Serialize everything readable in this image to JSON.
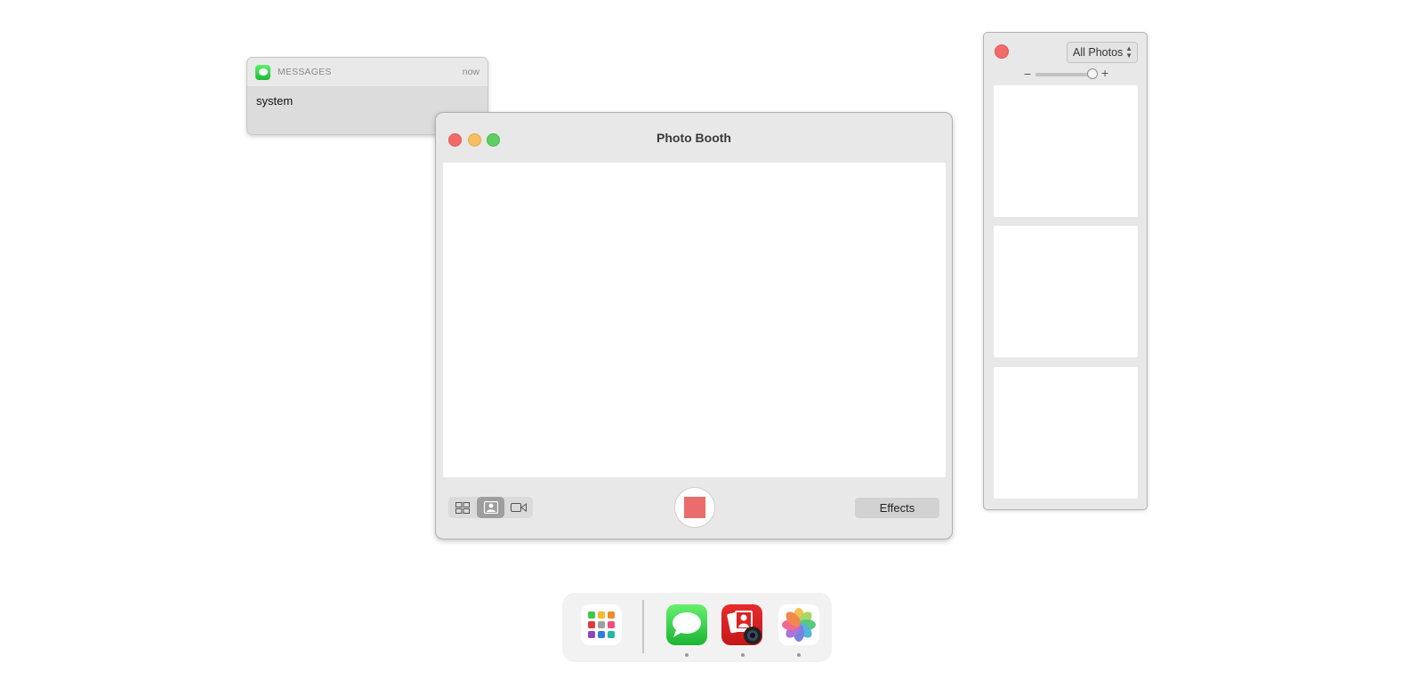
{
  "notification": {
    "app": "MESSAGES",
    "time": "now",
    "body": "system",
    "icon": "messages-icon"
  },
  "photo_booth": {
    "title": "Photo Booth",
    "view_modes": [
      "four-up-grid-icon",
      "single-photo-icon",
      "video-camera-icon"
    ],
    "active_view_mode": "single-photo-icon",
    "effects_label": "Effects",
    "shutter_color": "#ea6c6c"
  },
  "photo_browser": {
    "filter": "All Photos",
    "zoom_minus": "−",
    "zoom_plus": "+",
    "thumbnail_count": 3
  },
  "dock": {
    "apps": [
      {
        "name": "Launchpad",
        "icon": "launchpad-icon"
      },
      {
        "name": "Messages",
        "icon": "messages-icon",
        "running": true
      },
      {
        "name": "Photo Booth",
        "icon": "photo-booth-icon",
        "running": true
      },
      {
        "name": "Photos",
        "icon": "photos-icon",
        "running": true
      }
    ]
  },
  "colors": {
    "close": "#f26a6a",
    "minimize": "#f6bf5f",
    "maximize": "#5fce62"
  }
}
